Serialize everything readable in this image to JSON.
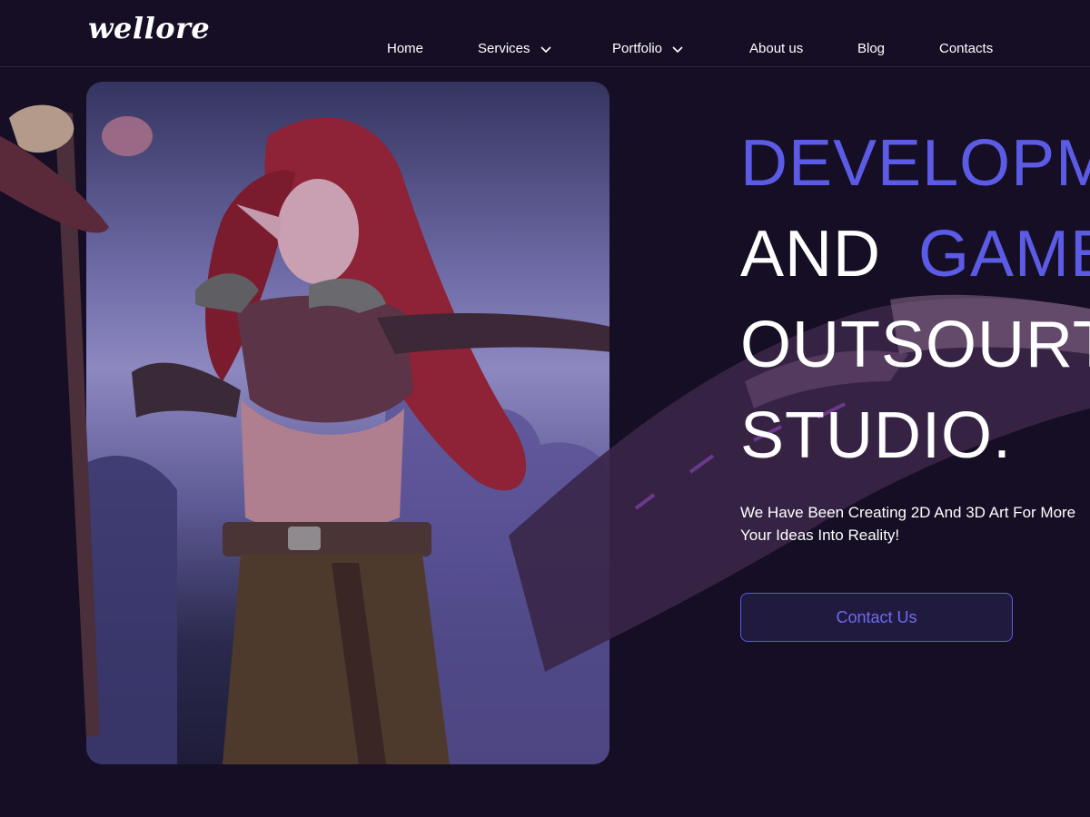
{
  "brand": {
    "logo_text": "wellore"
  },
  "nav": {
    "items": [
      {
        "label": "Home",
        "has_dropdown": false
      },
      {
        "label": "Services",
        "has_dropdown": true
      },
      {
        "label": "Portfolio",
        "has_dropdown": true
      },
      {
        "label": "About us",
        "has_dropdown": false
      },
      {
        "label": "Blog",
        "has_dropdown": false
      },
      {
        "label": "Contacts",
        "has_dropdown": false
      }
    ]
  },
  "hero": {
    "headline": {
      "line1": "DEVELOPM",
      "line2a": "AND ",
      "line2b": "GAME",
      "line3": "OUTSOURT",
      "line4": "STUDIO."
    },
    "subtext_line1": "We Have Been Creating 2D And 3D Art For More",
    "subtext_line2": "Your Ideas Into Reality!",
    "cta_label": "Contact Us",
    "image_alt_icon": "fantasy-elf-warrior-illustration"
  },
  "colors": {
    "background": "#150e24",
    "accent": "#5b5be6",
    "button_bg": "#211a3f",
    "text": "#ffffff"
  }
}
